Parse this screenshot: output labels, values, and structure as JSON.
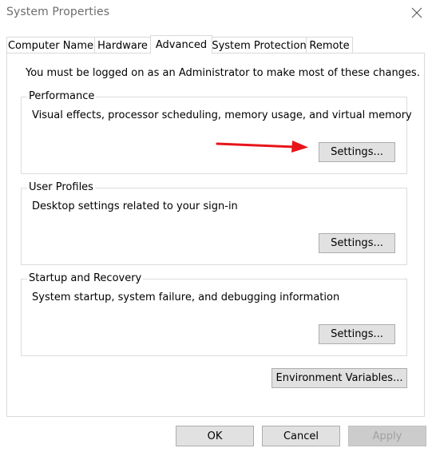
{
  "window": {
    "title": "System Properties"
  },
  "tabs": [
    {
      "label": "Computer Name",
      "active": false
    },
    {
      "label": "Hardware",
      "active": false
    },
    {
      "label": "Advanced",
      "active": true
    },
    {
      "label": "System Protection",
      "active": false
    },
    {
      "label": "Remote",
      "active": false
    }
  ],
  "advanced": {
    "admin_note": "You must be logged on as an Administrator to make most of these changes.",
    "performance": {
      "label": "Performance",
      "description": "Visual effects, processor scheduling, memory usage, and virtual memory",
      "button": "Settings..."
    },
    "user_profiles": {
      "label": "User Profiles",
      "description": "Desktop settings related to your sign-in",
      "button": "Settings..."
    },
    "startup_recovery": {
      "label": "Startup and Recovery",
      "description": "System startup, system failure, and debugging information",
      "button": "Settings..."
    },
    "env_button": "Environment Variables..."
  },
  "footer": {
    "ok": "OK",
    "cancel": "Cancel",
    "apply": "Apply"
  },
  "colors": {
    "annotation_arrow": "#e8141a",
    "button_face": "#e1e1e1",
    "border": "#d9d9d9"
  },
  "icons": {
    "close": "close-icon",
    "arrow": "red-arrow-annotation"
  }
}
